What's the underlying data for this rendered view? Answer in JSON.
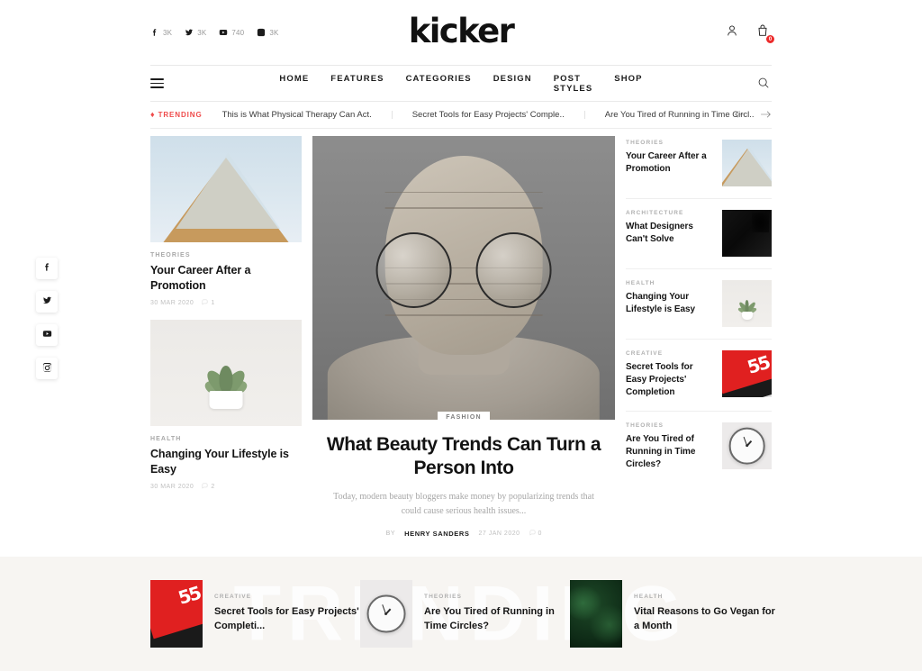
{
  "site": {
    "brand": "kicker"
  },
  "topbar": {
    "socials": [
      {
        "name": "facebook",
        "count": "3K"
      },
      {
        "name": "twitter",
        "count": "3K"
      },
      {
        "name": "youtube",
        "count": "740"
      },
      {
        "name": "instagram",
        "count": "3K"
      }
    ],
    "account_label": "Account",
    "cart_label": "Cart",
    "cart_count": "0"
  },
  "nav": {
    "menu": [
      {
        "label": "HOME"
      },
      {
        "label": "FEATURES"
      },
      {
        "label": "CATEGORIES"
      },
      {
        "label": "DESIGN"
      },
      {
        "label": "POST STYLES"
      },
      {
        "label": "SHOP"
      }
    ],
    "search_label": "Search"
  },
  "trending_strip": {
    "label": "TRENDING",
    "items": [
      {
        "text": "This is What Physical Therapy Can Act."
      },
      {
        "text": "Secret Tools for Easy Projects' Comple.."
      },
      {
        "text": "Are You Tired of Running in Time Circl.."
      }
    ],
    "prev_label": "Previous",
    "next_label": "Next"
  },
  "left_column": [
    {
      "category": "THEORIES",
      "title": "Your Career After a Promotion",
      "date": "30 MAR 2020",
      "comments": "1",
      "art": "art-pyramid"
    },
    {
      "category": "HEALTH",
      "title": "Changing Your Lifestyle is Easy",
      "date": "30 MAR 2020",
      "comments": "2",
      "art": "art-plant"
    }
  ],
  "hero": {
    "badge": "FASHION",
    "title": "What Beauty Trends Can Turn a Person Into",
    "excerpt": "Today, modern beauty bloggers make money by popularizing trends that could cause serious health issues...",
    "by_label": "BY",
    "author": "HENRY SANDERS",
    "date": "27 JAN 2020",
    "comments": "0"
  },
  "right_column": [
    {
      "category": "THEORIES",
      "title": "Your Career After a Promotion",
      "art": "art-pyramid"
    },
    {
      "category": "ARCHITECTURE",
      "title": "What Designers Can't Solve",
      "art": "art-dark"
    },
    {
      "category": "HEALTH",
      "title": "Changing Your Lifestyle is Easy",
      "art": "art-plant"
    },
    {
      "category": "CREATIVE",
      "title": "Secret Tools for Easy Projects' Completion",
      "art": "art-red"
    },
    {
      "category": "THEORIES",
      "title": "Are You Tired of Running in Time Circles?",
      "art": "art-clock"
    }
  ],
  "bottom_band": {
    "watermark": "TRENDING",
    "cards": [
      {
        "category": "CREATIVE",
        "title": "Secret Tools for Easy Projects' Completi...",
        "art": "art-red"
      },
      {
        "category": "THEORIES",
        "title": "Are You Tired of Running in Time Circles?",
        "art": "art-clock"
      },
      {
        "category": "HEALTH",
        "title": "Vital Reasons to Go Vegan for a Month",
        "art": "art-leaves"
      }
    ]
  },
  "social_rail": [
    {
      "name": "facebook"
    },
    {
      "name": "twitter"
    },
    {
      "name": "youtube"
    },
    {
      "name": "instagram"
    }
  ],
  "colors": {
    "accent_red": "#ef4b4b",
    "badge_red": "#ec2b2b",
    "band_bg": "#f7f5f2",
    "text": "#141414"
  }
}
